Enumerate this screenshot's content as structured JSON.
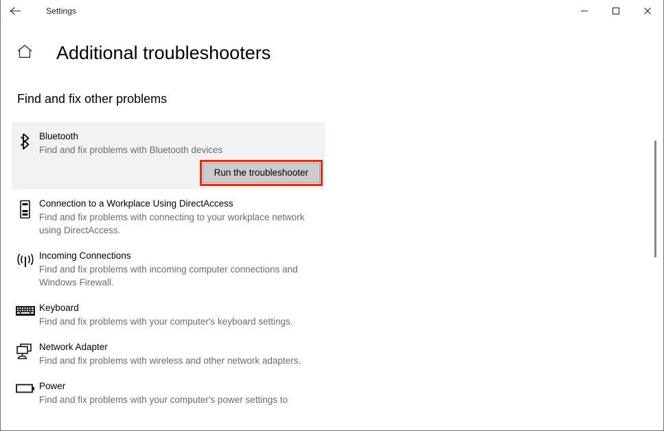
{
  "window": {
    "title": "Settings",
    "back_icon": "back-arrow-icon",
    "minimize_icon": "minimize-icon",
    "maximize_icon": "maximize-icon",
    "close_icon": "close-icon"
  },
  "header": {
    "home_icon": "home-icon",
    "title": "Additional troubleshooters"
  },
  "section": {
    "title": "Find and fix other problems"
  },
  "colors": {
    "selected_background": "#f2f2f2",
    "highlight_outline": "#ff2200",
    "button_face": "#cccccc",
    "description_text": "#6b6b6b"
  },
  "items": [
    {
      "icon": "bluetooth-icon",
      "name": "Bluetooth",
      "description": "Find and fix problems with Bluetooth devices",
      "selected": true,
      "button_label": "Run the troubleshooter"
    },
    {
      "icon": "workplace-device-icon",
      "name": "Connection to a Workplace Using DirectAccess",
      "description": "Find and fix problems with connecting to your workplace network using DirectAccess.",
      "selected": false
    },
    {
      "icon": "incoming-connections-icon",
      "name": "Incoming Connections",
      "description": "Find and fix problems with incoming computer connections and Windows Firewall.",
      "selected": false
    },
    {
      "icon": "keyboard-icon",
      "name": "Keyboard",
      "description": "Find and fix problems with your computer's keyboard settings.",
      "selected": false
    },
    {
      "icon": "network-adapter-icon",
      "name": "Network Adapter",
      "description": "Find and fix problems with wireless and other network adapters.",
      "selected": false
    },
    {
      "icon": "power-battery-icon",
      "name": "Power",
      "description": "Find and fix problems with your computer's power settings to",
      "selected": false
    }
  ],
  "scrollbar": {
    "name": "vertical-scrollbar"
  }
}
